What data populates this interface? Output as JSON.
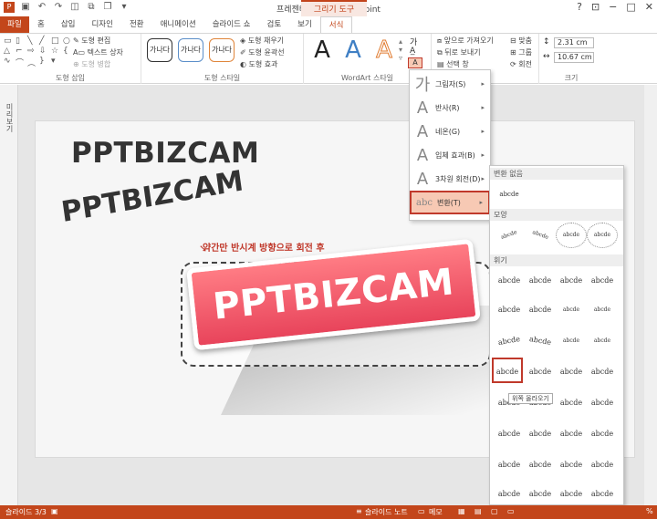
{
  "titlebar": {
    "title": "프레젠테이션2 - PowerPoint",
    "context_tab": "그리기 도구"
  },
  "tabs": [
    "파일",
    "홈",
    "삽입",
    "디자인",
    "전환",
    "애니메이션",
    "슬라이드 쇼",
    "검토",
    "보기",
    "서식"
  ],
  "ribbon": {
    "insert_shapes": {
      "edit_shape": "도형 편집",
      "text_box": "텍스트 상자",
      "merge_shapes": "도형 병합",
      "label": "도형 삽입"
    },
    "shape_styles": {
      "swatch": "가나다",
      "fill": "도형 채우기",
      "outline": "도형 윤곽선",
      "effects": "도형 효과",
      "label": "도형 스타일"
    },
    "wordart": {
      "sample": "A",
      "label": "WordArt 스타일",
      "text_icon": "가"
    },
    "arrange": {
      "bring_forward": "앞으로 가져오기",
      "send_backward": "뒤로 보내기",
      "selection_pane": "선택 창",
      "align": "맞춤",
      "group": "그룹",
      "rotate": "회전"
    },
    "size": {
      "height": "2.31 cm",
      "width": "10.67 cm",
      "label": "크기"
    }
  },
  "leftstrip": {
    "label": "미리보기"
  },
  "slide": {
    "text1": "PPTBIZCAM",
    "text2": "PPTBIZCAM",
    "annotation": "약간만 반시계 방향으로 회전 후",
    "banner": "PPTBIZCAM"
  },
  "effects_menu": [
    {
      "icon": "가",
      "label": "그림자(S)"
    },
    {
      "icon": "A",
      "label": "반사(R)"
    },
    {
      "icon": "A",
      "label": "네온(G)"
    },
    {
      "icon": "A",
      "label": "입체 효과(B)"
    },
    {
      "icon": "A",
      "label": "3차원 회전(D)"
    },
    {
      "icon": "abc",
      "label": "변환(T)"
    }
  ],
  "gallery": {
    "no_transform_header": "변환 없음",
    "no_transform_sample": "abcde",
    "path_header": "모양",
    "warp_header": "휘기",
    "sample": "abcde",
    "tooltip": "위쪽 올라오기"
  },
  "status": {
    "slide": "슬라이드 3/3",
    "notes": "슬라이드 노트",
    "comments": "메모",
    "zoom": "%"
  },
  "colors": {
    "accent": "#c3461b",
    "banner": "#e8445b",
    "highlight": "#c0392b"
  }
}
